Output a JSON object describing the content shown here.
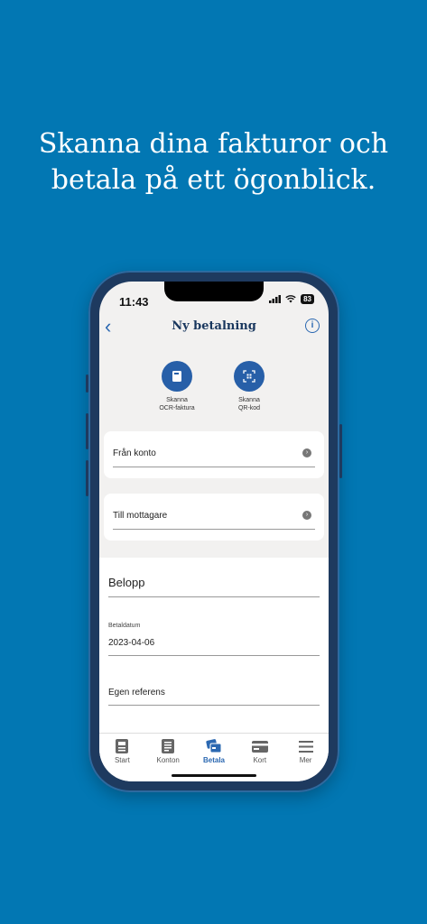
{
  "headline": {
    "line1": "Skanna dina fakturor och",
    "line2": "betala på ett ögonblick."
  },
  "status": {
    "time": "11:43",
    "battery": "83"
  },
  "nav": {
    "title": "Ny betalning"
  },
  "scan": {
    "ocr": {
      "line1": "Skanna",
      "line2": "OCR-faktura"
    },
    "qr": {
      "line1": "Skanna",
      "line2": "QR-kod"
    }
  },
  "fields": {
    "from": "Från konto",
    "to": "Till mottagare",
    "amount": "Belopp",
    "date_label": "Betaldatum",
    "date_value": "2023-04-06",
    "reference": "Egen referens"
  },
  "tabs": [
    {
      "label": "Start",
      "icon": "home-icon"
    },
    {
      "label": "Konton",
      "icon": "accounts-icon"
    },
    {
      "label": "Betala",
      "icon": "pay-icon",
      "active": true
    },
    {
      "label": "Kort",
      "icon": "card-icon"
    },
    {
      "label": "Mer",
      "icon": "menu-icon"
    }
  ],
  "colors": {
    "background": "#0277b3",
    "accent": "#2b68b1",
    "scan_button": "#275fa8"
  }
}
